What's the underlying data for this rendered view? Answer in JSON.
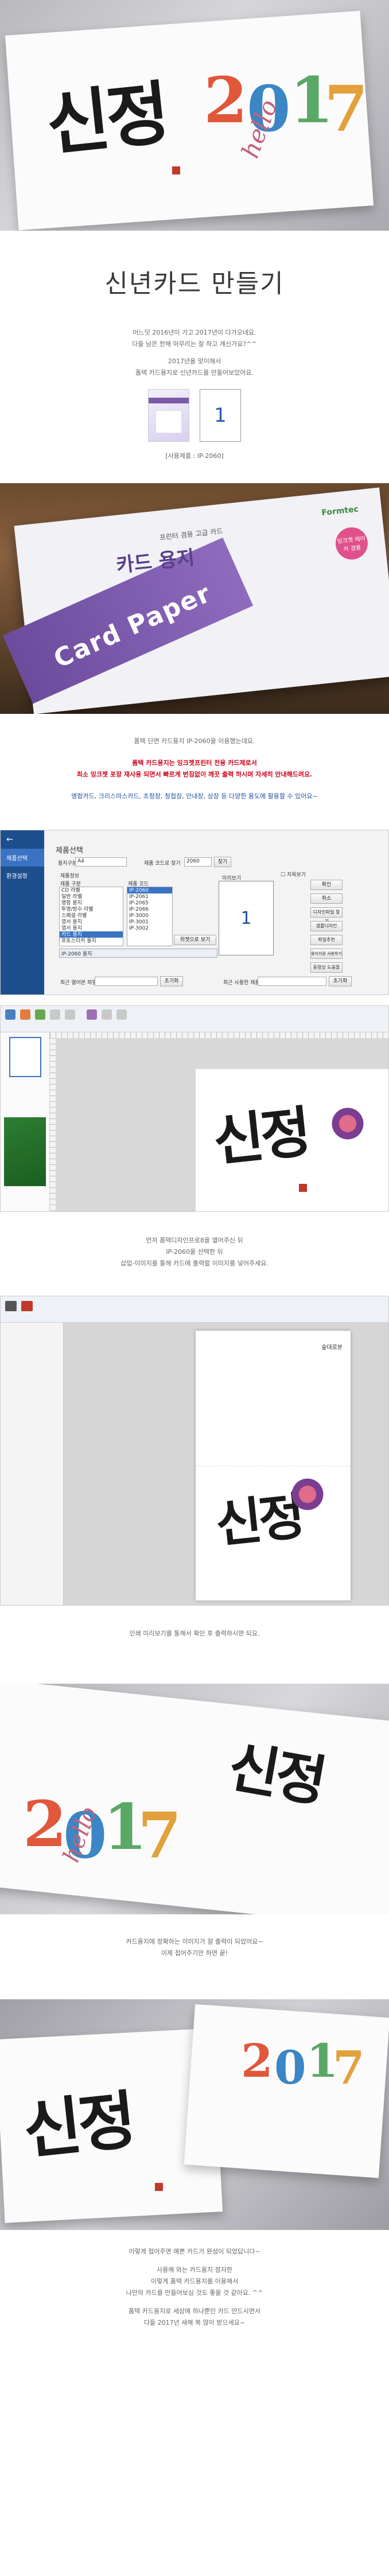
{
  "title": "신년카드 만들기",
  "intro": {
    "lines": [
      "어느덧 2016년이 가고 2017년이 다가오네요.",
      "다들 남은 한해 마무리는 잘 하고 계신가요?^^",
      "",
      "2017년을 맞이해서",
      "폼텍 카드용지로 신년카드를 만들어보았어요."
    ]
  },
  "product_caption": "[사용제품 : IP-2060]",
  "sheet_number": "1",
  "package": {
    "brand": "Formtec",
    "subtitle": "프린터 겸용 고급 카드",
    "title": "카드 용지",
    "cover_text": "Card Paper",
    "badge": "잉크젯 레이저 겸용"
  },
  "desc": {
    "line1": "폼텍 단면 카드용지 IP-2060을 이용했는데요.",
    "red1": "폼텍 카드용지는 잉크젯프린터 전용 카드제로서",
    "red2": "최소 잉크젯 포장 재사용 되면서 빠르게 번짐없이 깨끗 출력 하시며 자세히 안내해드려요.",
    "blue": "명함카드, 크리스마스카드, 초청장, 청첩장, 안내장, 상장 등 다양한 용도에 활용할 수 있어요~"
  },
  "app1": {
    "sidebar": [
      "제품선택",
      "환경설정"
    ],
    "header": "제품선택",
    "type_label": "용지구분",
    "type_value": "A4",
    "code_label": "제품 코드로 찾기",
    "code_value": "2060",
    "find_btn": "찾기",
    "group_label": "제품정보",
    "col1": "제품 구분",
    "col2": "제품 코드",
    "categories": [
      "CD 라벨",
      "일반 라벨",
      "명함 용지",
      "투명/방수 라벨",
      "스페셜 라벨",
      "엽서 용지",
      "엽서 용지",
      "카드 용지",
      "포토스티커 용지"
    ],
    "codes": [
      "IP-2060",
      "IP-2061",
      "IP-2065",
      "IP-2066",
      "IP-3000",
      "IP-3001",
      "IP-3002"
    ],
    "selected": "IP-2060 용지",
    "preview_label": "미리보기",
    "preview_num": "1",
    "check": "지옥보기",
    "right_btns": [
      "확인",
      "취소",
      "디자인파일 찾기",
      "샘플디자인",
      "파일추천",
      "용지지원 사용하기",
      "동영상 도움말"
    ],
    "bottom1": "최근 열어본 파일",
    "bottom2": "최근 사용한 제품",
    "bottom_btn": "초기화",
    "small_btn": "위젯으로 보기"
  },
  "caption2": {
    "line1": "먼저 폼텍디자인프로8을 열어주신 뒤",
    "line2": "IP-2060을 선택한 뒤",
    "line3": "삽입-이미지를 통해 카드에 출력할 이미지를 넣어주세요."
  },
  "caption3": "인쇄 미리보기를 통해서 확인 후 출력하시면 되요.",
  "print_preview_text": "숲대로분",
  "caption4": {
    "line1": "카드용지에 정확하는 이미지가 잘 출력이 되었어요~",
    "line2": "이제 접어주기만 하면 끝!"
  },
  "card_art": {
    "calligraphy": "신정",
    "year": "2017",
    "hello": "hello"
  },
  "outro": {
    "lines": [
      "이렇게 접어주면 예쁜 카드가 완성이 되었답니다~",
      "",
      "사용해 와는 카드용지 정자한",
      "이렇게 폼텍 카드용지를 이용해서",
      "나만의 카드를 만들어보심 것도 좋을 것 같아요. ^^",
      "",
      "폼텍 카드용지로 세상에 하나뿐인 카드 만드시면서",
      "다들 2017년 새해 복 많이 받으세요~"
    ]
  },
  "colors": {
    "yr2": "#e0573a",
    "yr0": "#3b86c4",
    "yr1": "#5aa865",
    "yr7": "#e2a13a",
    "accent": "#1d4f8f"
  }
}
